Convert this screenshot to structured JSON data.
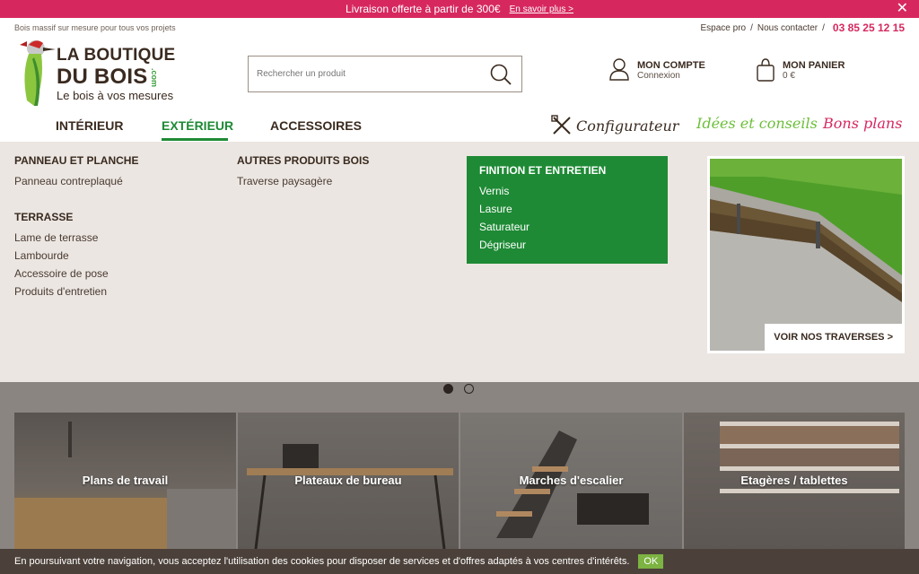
{
  "promo_bar": {
    "text": "Livraison offerte à partir de 300€",
    "link": "En savoir plus",
    "link_arrow": ">",
    "close": "✕"
  },
  "header": {
    "tagline": "Bois massif sur mesure pour tous vos projets",
    "utility": {
      "pro": "Espace pro",
      "sep1": "/",
      "contact": "Nous contacter",
      "sep2": "/",
      "phone": "03 85 25 12 15"
    },
    "logo": {
      "line1": "LA BOUTIQUE",
      "line2": "DU BOIS",
      "com": ".com",
      "line3": "Le bois à vos mesures"
    },
    "search": {
      "placeholder": "Rechercher un produit"
    },
    "account": {
      "title": "MON COMPTE",
      "sub": "Connexion"
    },
    "cart": {
      "title": "MON PANIER",
      "sub": "0 €"
    }
  },
  "nav": {
    "items": [
      "INTÉRIEUR",
      "EXTÉRIEUR",
      "ACCESSOIRES"
    ],
    "configurateur": "Configurateur",
    "idees": "Idées et conseils",
    "bons_plans": "Bons plans"
  },
  "mega_menu": {
    "panneau": {
      "title": "PANNEAU ET PLANCHE",
      "links": [
        "Panneau contreplaqué"
      ]
    },
    "terrasse": {
      "title": "TERRASSE",
      "links": [
        "Lame de terrasse",
        "Lambourde",
        "Accessoire de pose",
        "Produits d'entretien"
      ]
    },
    "autres": {
      "title": "AUTRES PRODUITS BOIS",
      "links": [
        "Traverse paysagère"
      ]
    },
    "finition": {
      "title": "FINITION ET ENTRETIEN",
      "links": [
        "Vernis",
        "Lasure",
        "Saturateur",
        "Dégriseur"
      ]
    },
    "promo_cta": "VOIR NOS TRAVERSES >"
  },
  "tiles": [
    "Plans de travail",
    "Plateaux de bureau",
    "Marches d'escalier",
    "Etagères / tablettes"
  ],
  "cookie": {
    "text": "En poursuivant votre navigation, vous acceptez l'utilisation des cookies pour disposer de services et d'offres adaptés à vos centres d'intérêts.",
    "ok": "OK"
  },
  "colors": {
    "brand_pink": "#d6285f",
    "brand_green": "#1e8a35",
    "light_green": "#6cbf3a",
    "brown": "#3a2a1f"
  }
}
